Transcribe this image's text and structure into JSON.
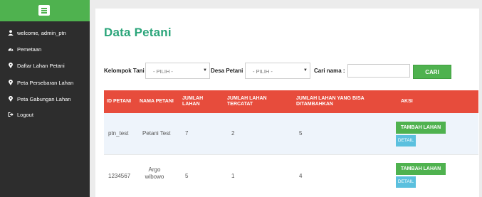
{
  "sidebar": {
    "items": [
      {
        "label": "welcome, admin_ptn",
        "icon": "user-icon"
      },
      {
        "label": "Pemetaan",
        "icon": "dashboard-icon"
      },
      {
        "label": "Daftar Lahan Petani",
        "icon": "map-marker-icon"
      },
      {
        "label": "Peta Persebaran Lahan",
        "icon": "map-marker-icon"
      },
      {
        "label": "Peta Gabungan Lahan",
        "icon": "map-marker-icon"
      },
      {
        "label": "Logout",
        "icon": "sign-out-icon"
      }
    ]
  },
  "main": {
    "title": "Data Petani",
    "filters": {
      "kelompok_label": "Kelompok Tani :",
      "kelompok_value": "- PILIH -",
      "desa_label": "Desa Petani :",
      "desa_value": "- PILIH -",
      "nama_label": "Cari nama :",
      "nama_value": "",
      "search_button": "CARI"
    },
    "table": {
      "headers": [
        "ID PETANI",
        "NAMA PETANI",
        "JUMLAH LAHAN",
        "JUMLAH LAHAN TERCATAT",
        "JUMLAH LAHAN YANG BISA DITAMBAHKAN",
        "AKSI"
      ],
      "rows": [
        {
          "id": "ptn_test",
          "nama": "Petani Test",
          "jumlah": "7",
          "tercatat": "2",
          "bisa": "5",
          "tambah": "TAMBAH LAHAN",
          "detail": "DETAIL"
        },
        {
          "id": "1234567",
          "nama": "Argo wibowo",
          "jumlah": "5",
          "tercatat": "1",
          "bisa": "4",
          "tambah": "TAMBAH LAHAN",
          "detail": "DETAIL"
        }
      ]
    }
  },
  "colors": {
    "sidebar_bg": "#2d2d2d",
    "accent_green": "#4fb24f",
    "title_green": "#2aa57a",
    "table_header_red": "#e74c3c",
    "detail_blue": "#5bc0de"
  }
}
